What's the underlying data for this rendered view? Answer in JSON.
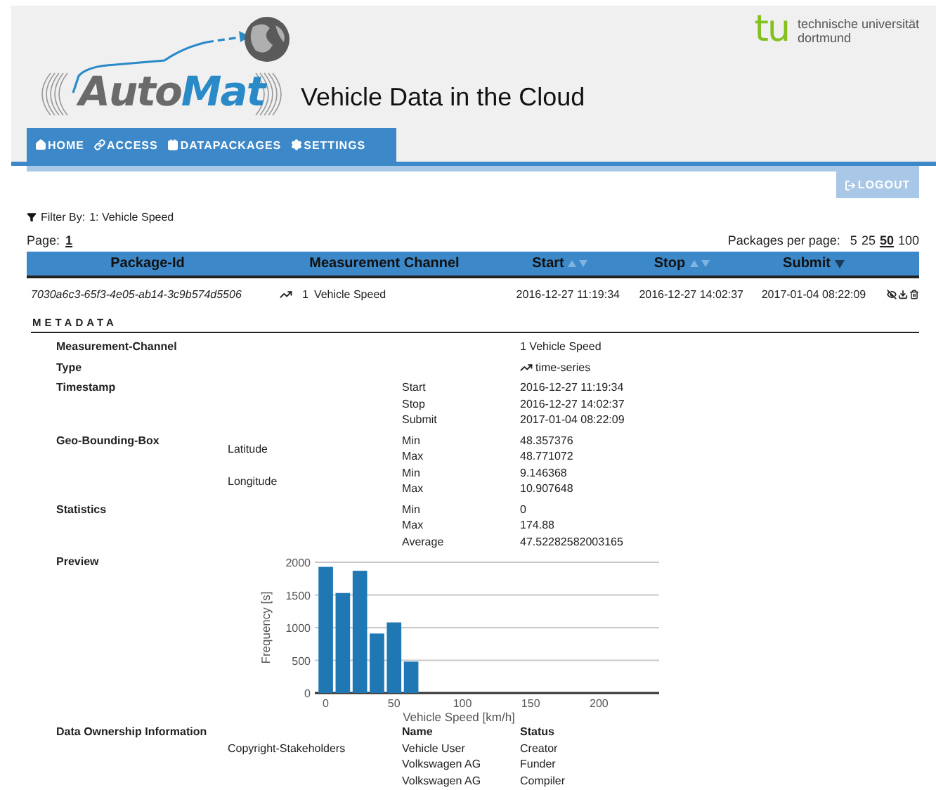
{
  "header": {
    "logo": {
      "first": "Auto",
      "second": "Mat"
    },
    "title": "Vehicle Data in the Cloud",
    "university": {
      "mark": "tu",
      "lines": [
        "technische universität",
        "dortmund"
      ]
    }
  },
  "nav": {
    "items": [
      {
        "label": "HOME",
        "selected": false
      },
      {
        "label": "ACCESS",
        "selected": false
      },
      {
        "label": "DATAPACKAGES",
        "selected": false
      },
      {
        "label": "SETTINGS",
        "selected": false
      }
    ],
    "logout": "LOGOUT"
  },
  "filter": {
    "label": "Filter By:",
    "value": "1: Vehicle Speed"
  },
  "pagination": {
    "label": "Page:",
    "pages": [
      {
        "label": "1",
        "selected": true
      }
    ]
  },
  "per_page": {
    "label": "Packages per page:",
    "options": [
      {
        "label": "5",
        "selected": false
      },
      {
        "label": "25",
        "selected": false
      },
      {
        "label": "50",
        "selected": true
      },
      {
        "label": "100",
        "selected": false
      }
    ]
  },
  "table": {
    "columns": [
      {
        "label": "Package-Id",
        "kind": "plain"
      },
      {
        "label": "Measurement Channel",
        "kind": "plain"
      },
      {
        "label": "Start",
        "kind": "sortable"
      },
      {
        "label": "Stop",
        "kind": "sortable"
      },
      {
        "label": "Submit",
        "kind": "sorted"
      }
    ],
    "rows": [
      {
        "package_id": "7030a6c3-65f3-4e05-ab14-3c9b574d5506",
        "channel_number": "1",
        "channel_name": "Vehicle Speed",
        "start": "2016-12-27 11:19:34",
        "stop": "2016-12-27 14:02:37",
        "submit": "2017-01-04 08:22:09"
      }
    ]
  },
  "metadata": {
    "title": "METADATA",
    "sections": [
      {
        "label": "Measurement-Channel",
        "groups": [
          {
            "entries": [
              {
                "value": "1 Vehicle Speed"
              }
            ]
          }
        ]
      },
      {
        "label": "Type",
        "groups": [
          {
            "entries": [
              {
                "value": "time-series",
                "kind": "chart"
              }
            ]
          }
        ]
      },
      {
        "label": "Timestamp",
        "groups": [
          {
            "entries": [
              {
                "key": "Start",
                "value": "2016-12-27 11:19:34"
              },
              {
                "key": "Stop",
                "value": "2016-12-27 14:02:37"
              },
              {
                "key": "Submit",
                "value": "2017-01-04 08:22:09"
              }
            ]
          }
        ]
      },
      {
        "label": "Geo-Bounding-Box",
        "groups": [
          {
            "name": "Latitude",
            "entries": [
              {
                "key": "Min",
                "value": "48.357376"
              },
              {
                "key": "Max",
                "value": "48.771072"
              }
            ]
          },
          {
            "name": "Longitude",
            "entries": [
              {
                "key": "Min",
                "value": "9.146368"
              },
              {
                "key": "Max",
                "value": "10.907648"
              }
            ]
          }
        ]
      },
      {
        "label": "Statistics",
        "groups": [
          {
            "entries": [
              {
                "key": "Min",
                "value": "0"
              },
              {
                "key": "Max",
                "value": "174.88"
              },
              {
                "key": "Average",
                "value": "47.52282582003165"
              }
            ]
          }
        ]
      }
    ],
    "preview": {
      "label": "Preview",
      "chart_data": {
        "type": "bar",
        "xlabel": "Vehicle Speed [km/h]",
        "ylabel": "Frequency [s]",
        "x": [
          0,
          12.5,
          25,
          37.5,
          50,
          62.5
        ],
        "values": [
          1930,
          1530,
          1870,
          910,
          1080,
          480
        ],
        "xlim": [
          -8,
          244
        ],
        "ylim": [
          0,
          2000
        ],
        "xticks": [
          0,
          50,
          100,
          150,
          200
        ],
        "yticks": [
          0,
          500,
          1000,
          1500,
          2000
        ],
        "grid": true
      }
    },
    "ownership": {
      "label": "Data Ownership Information",
      "sublabel": "Copyright-Stakeholders",
      "columns": [
        "Name",
        "Status"
      ],
      "rows": [
        [
          "Vehicle User",
          "Creator"
        ],
        [
          "Volkswagen AG",
          "Funder"
        ],
        [
          "Volkswagen AG",
          "Compiler"
        ]
      ]
    }
  }
}
